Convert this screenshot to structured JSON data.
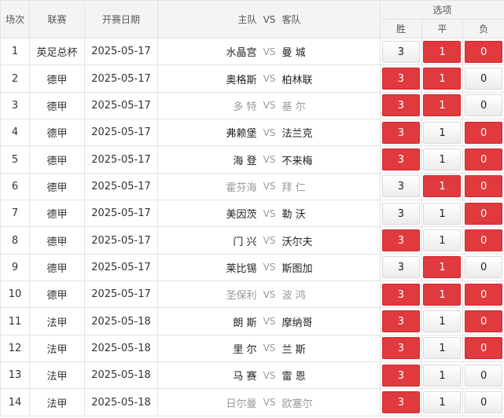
{
  "headers": {
    "index": "场次",
    "league": "联赛",
    "date": "开赛日期",
    "home": "主队",
    "vs": "VS",
    "away": "客队",
    "options": "选项",
    "win": "胜",
    "draw": "平",
    "lose": "负"
  },
  "colors": {
    "selected": "#e0393e",
    "unselected": "#f2f2f2"
  },
  "rows": [
    {
      "idx": "1",
      "league": "英足总杯",
      "date": "2025-05-17",
      "home": "水晶宫",
      "away": "曼 城",
      "gray": false,
      "win": "3",
      "draw": "1",
      "lose": "0",
      "sel": [
        false,
        true,
        true
      ]
    },
    {
      "idx": "2",
      "league": "德甲",
      "date": "2025-05-17",
      "home": "奥格斯",
      "away": "柏林联",
      "gray": false,
      "win": "3",
      "draw": "1",
      "lose": "0",
      "sel": [
        true,
        true,
        false
      ]
    },
    {
      "idx": "3",
      "league": "德甲",
      "date": "2025-05-17",
      "home": "多 特",
      "away": "基 尔",
      "gray": true,
      "win": "3",
      "draw": "1",
      "lose": "0",
      "sel": [
        true,
        true,
        false
      ]
    },
    {
      "idx": "4",
      "league": "德甲",
      "date": "2025-05-17",
      "home": "弗赖堡",
      "away": "法兰克",
      "gray": false,
      "win": "3",
      "draw": "1",
      "lose": "0",
      "sel": [
        true,
        false,
        true
      ]
    },
    {
      "idx": "5",
      "league": "德甲",
      "date": "2025-05-17",
      "home": "海 登",
      "away": "不来梅",
      "gray": false,
      "win": "3",
      "draw": "1",
      "lose": "0",
      "sel": [
        true,
        false,
        true
      ]
    },
    {
      "idx": "6",
      "league": "德甲",
      "date": "2025-05-17",
      "home": "霍芬海",
      "away": "拜 仁",
      "gray": true,
      "win": "3",
      "draw": "1",
      "lose": "0",
      "sel": [
        false,
        true,
        true
      ]
    },
    {
      "idx": "7",
      "league": "德甲",
      "date": "2025-05-17",
      "home": "美因茨",
      "away": "勒 沃",
      "gray": false,
      "win": "3",
      "draw": "1",
      "lose": "0",
      "sel": [
        false,
        false,
        true
      ]
    },
    {
      "idx": "8",
      "league": "德甲",
      "date": "2025-05-17",
      "home": "门 兴",
      "away": "沃尔夫",
      "gray": false,
      "win": "3",
      "draw": "1",
      "lose": "0",
      "sel": [
        true,
        false,
        true
      ]
    },
    {
      "idx": "9",
      "league": "德甲",
      "date": "2025-05-17",
      "home": "莱比锡",
      "away": "斯图加",
      "gray": false,
      "win": "3",
      "draw": "1",
      "lose": "0",
      "sel": [
        false,
        true,
        false
      ]
    },
    {
      "idx": "10",
      "league": "德甲",
      "date": "2025-05-17",
      "home": "圣保利",
      "away": "波 鸿",
      "gray": true,
      "win": "3",
      "draw": "1",
      "lose": "0",
      "sel": [
        true,
        true,
        true
      ]
    },
    {
      "idx": "11",
      "league": "法甲",
      "date": "2025-05-18",
      "home": "朗 斯",
      "away": "摩纳哥",
      "gray": false,
      "win": "3",
      "draw": "1",
      "lose": "0",
      "sel": [
        true,
        false,
        true
      ]
    },
    {
      "idx": "12",
      "league": "法甲",
      "date": "2025-05-18",
      "home": "里 尔",
      "away": "兰 斯",
      "gray": false,
      "win": "3",
      "draw": "1",
      "lose": "0",
      "sel": [
        true,
        false,
        true
      ]
    },
    {
      "idx": "13",
      "league": "法甲",
      "date": "2025-05-18",
      "home": "马 赛",
      "away": "雷 恩",
      "gray": false,
      "win": "3",
      "draw": "1",
      "lose": "0",
      "sel": [
        true,
        false,
        false
      ]
    },
    {
      "idx": "14",
      "league": "法甲",
      "date": "2025-05-18",
      "home": "日尔曼",
      "away": "欧塞尔",
      "gray": true,
      "win": "3",
      "draw": "1",
      "lose": "0",
      "sel": [
        true,
        false,
        false
      ]
    }
  ]
}
